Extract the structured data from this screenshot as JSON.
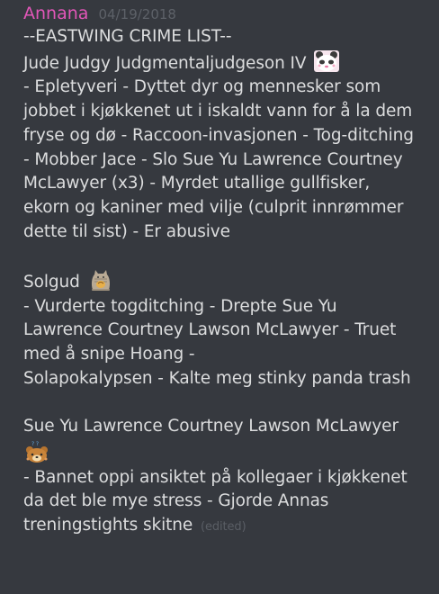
{
  "message": {
    "author": "Annana",
    "timestamp": "04/19/2018",
    "author_color": "#e256b8",
    "edited_label": "(edited)",
    "lines": {
      "l0": "--EASTWING CRIME LIST--",
      "l1": "Jude Judgy Judgmentaljudgeson IV",
      "l2": "- Epletyveri  - Dyttet dyr og mennesker som",
      "l3": "jobbet i kjøkkenet ut i iskaldt vann for å la dem",
      "l4": "fryse og dø - Raccoon-invasjonen - Tog-ditching",
      "l5": "- Mobber Jace - Slo Sue Yu Lawrence Courtney",
      "l6": "McLawyer (x3) - Myrdet utallige gullfisker,",
      "l7": "ekorn og kaniner med vilje (culprit innrømmer",
      "l8": "dette til sist) - Er abusive",
      "l9": "Solgud",
      "l10": "- Vurderte togditching - Drepte Sue Yu",
      "l11": "Lawrence Courtney Lawson McLawyer - Truet",
      "l12": "med å snipe Hoang -",
      "l13": "Solapokalypsen - Kalte meg stinky panda trash",
      "l14": "Sue Yu Lawrence Courtney Lawson McLawyer",
      "l15": "- Bannet oppi ansiktet på kollegaer i kjøkkenet",
      "l16": "da det ble mye stress - Gjorde Annas",
      "l17": "treningstights skitne"
    },
    "emojis": [
      "panda-face-emoji",
      "pusheen-cat-emoji",
      "rilakkuma-bear-emoji"
    ]
  },
  "colors": {
    "background": "#36393f",
    "text": "#dcddde",
    "muted": "#5d6168"
  }
}
